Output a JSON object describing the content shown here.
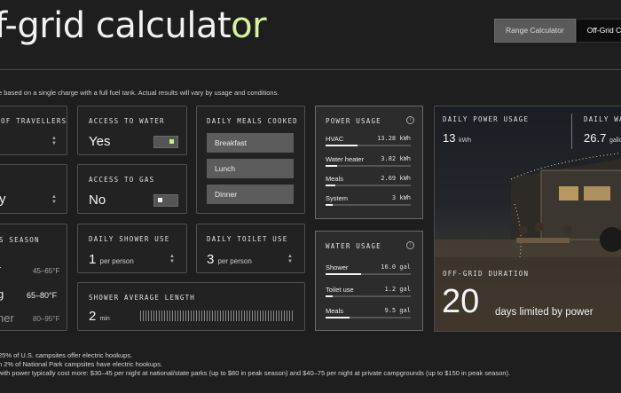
{
  "header": {
    "title_main": "f-grid calculat",
    "title_accent": "or",
    "tabs": [
      {
        "label": "Range Calculator",
        "active": false
      },
      {
        "label": "Off-Grid C",
        "active": true
      }
    ]
  },
  "note": "e based on a single charge with a full fuel tank. Actual results will vary by usage and conditions.",
  "inputs": {
    "travellers": {
      "label": "OF TRAVELLERS"
    },
    "water": {
      "label": "ACCESS TO WATER",
      "value": "Yes",
      "toggle_on": true
    },
    "gas": {
      "label": "ACCESS TO GAS",
      "value": "No",
      "toggle_on": false
    },
    "partial_left": {
      "label": "",
      "value": "y"
    },
    "season": {
      "label": "S SEASON",
      "rows": [
        {
          "name": "r",
          "range": "45–65°F"
        },
        {
          "name": "g",
          "range": "65–80°F"
        },
        {
          "name": "her",
          "range": "80–95°F"
        }
      ]
    },
    "shower": {
      "label": "DAILY SHOWER USE",
      "value": "1",
      "unit": "per person"
    },
    "toilet": {
      "label": "DAILY TOILET USE",
      "value": "3",
      "unit": "per person"
    },
    "shower_length": {
      "label": "SHOWER AVERAGE LENGTH",
      "value": "2",
      "unit": "min"
    },
    "meals": {
      "label": "DAILY MEALS COOKED",
      "items": [
        "Breakfast",
        "Lunch",
        "Dinner"
      ]
    }
  },
  "power_usage": {
    "label": "POWER USAGE",
    "rows": [
      {
        "name": "HVAC",
        "value": "13.28 kWh",
        "fraction": 0.38
      },
      {
        "name": "Water heater",
        "value": "3.82 kWh",
        "fraction": 0.14
      },
      {
        "name": "Meals",
        "value": "2.69 kWh",
        "fraction": 0.11
      },
      {
        "name": "System",
        "value": "3 kWh",
        "fraction": 0.08
      }
    ]
  },
  "water_usage": {
    "label": "WATER USAGE",
    "rows": [
      {
        "name": "Shower",
        "value": "16.0 gal",
        "fraction": 0.42
      },
      {
        "name": "Toilet use",
        "value": "1.2 gal",
        "fraction": 0.08
      },
      {
        "name": "Meals",
        "value": "9.5 gal",
        "fraction": 0.28
      }
    ]
  },
  "results": {
    "daily_power_label": "DAILY POWER USAGE",
    "daily_power_value": "13",
    "daily_power_unit": "kWh",
    "daily_water_label": "DAILY WAT",
    "daily_water_value": "26.7",
    "daily_water_unit": "gallo",
    "duration_label": "OFF-GRID DURATION",
    "duration_value": "20",
    "duration_text": "days limited by power"
  },
  "footnotes": [
    "25% of U.S. campsites offer electric hookups.",
    "n 2% of National Park campsites have electric hookups.",
    " with power typically cost more: $30–45 per night at national/state parks (up to $80 in peak season) and $40–75 per night at private campgrounds (up to $150 in peak season)."
  ],
  "colors": {
    "accent": "#d6f29c",
    "toggle_on": "#c8f07a"
  }
}
